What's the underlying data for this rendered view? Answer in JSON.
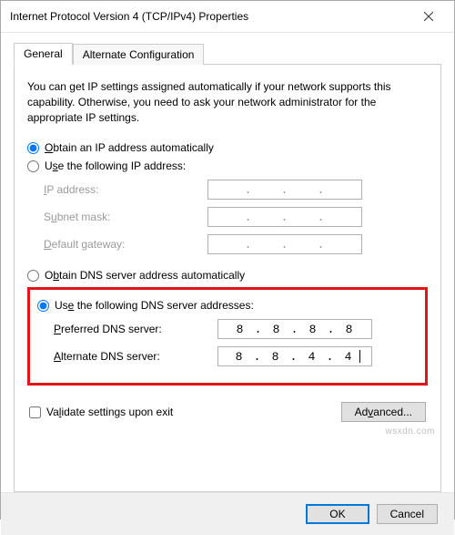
{
  "window": {
    "title": "Internet Protocol Version 4 (TCP/IPv4) Properties"
  },
  "tabs": {
    "general": "General",
    "alternate": "Alternate Configuration"
  },
  "description": "You can get IP settings assigned automatically if your network supports this capability. Otherwise, you need to ask your network administrator for the appropriate IP settings.",
  "ip": {
    "radio_auto": "Obtain an IP address automatically",
    "radio_manual": "Use the following IP address:",
    "label_ip": "IP address:",
    "label_subnet": "Subnet mask:",
    "label_gateway": "Default gateway:",
    "value_ip": "",
    "value_subnet": "",
    "value_gateway": ""
  },
  "dns": {
    "radio_auto": "Obtain DNS server address automatically",
    "radio_manual": "Use the following DNS server addresses:",
    "label_preferred": "Preferred DNS server:",
    "label_alternate": "Alternate DNS server:",
    "preferred": [
      "8",
      "8",
      "8",
      "8"
    ],
    "alternate": [
      "8",
      "8",
      "4",
      "4"
    ]
  },
  "validate_label": "Validate settings upon exit",
  "advanced_label": "Advanced...",
  "buttons": {
    "ok": "OK",
    "cancel": "Cancel"
  },
  "watermark": "wsxdn.com"
}
